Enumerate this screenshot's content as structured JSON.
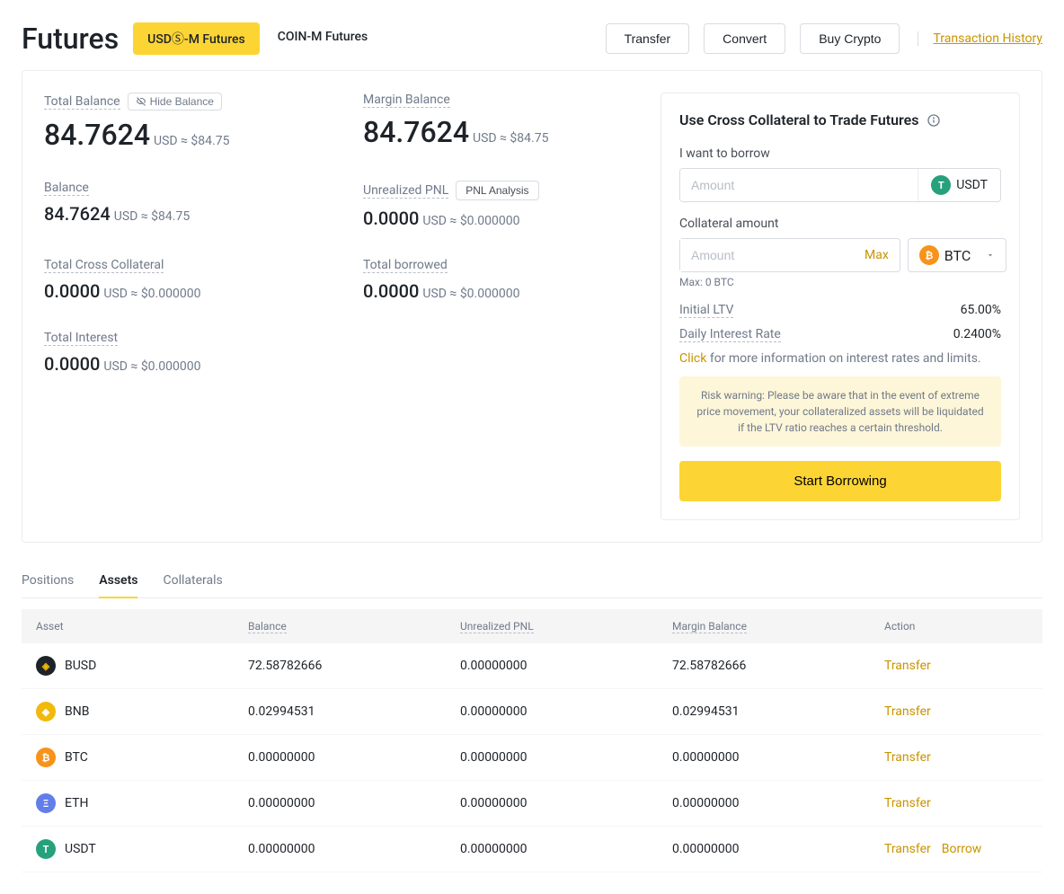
{
  "header": {
    "title": "Futures",
    "tabs": [
      "USDⓈ-M Futures",
      "COIN-M Futures"
    ],
    "buttons": {
      "transfer": "Transfer",
      "convert": "Convert",
      "buy": "Buy Crypto"
    },
    "history_link": "Transaction History"
  },
  "balances": {
    "total": {
      "label": "Total Balance",
      "hide_btn": "Hide Balance",
      "value": "84.7624",
      "suffix": "USD ≈ $84.75"
    },
    "margin": {
      "label": "Margin Balance",
      "value": "84.7624",
      "suffix": "USD ≈ $84.75"
    },
    "balance": {
      "label": "Balance",
      "value": "84.7624",
      "suffix": "USD ≈ $84.75"
    },
    "upnl": {
      "label": "Unrealized PNL",
      "pnl_btn": "PNL Analysis",
      "value": "0.0000",
      "suffix": "USD ≈ $0.000000"
    },
    "cross": {
      "label": "Total Cross Collateral",
      "value": "0.0000",
      "suffix": "USD ≈ $0.000000"
    },
    "borrowed": {
      "label": "Total borrowed",
      "value": "0.0000",
      "suffix": "USD ≈ $0.000000"
    },
    "interest": {
      "label": "Total Interest",
      "value": "0.0000",
      "suffix": "USD ≈ $0.000000"
    }
  },
  "borrow": {
    "header": "Use Cross Collateral to Trade Futures",
    "want_label": "I want to borrow",
    "amount_placeholder": "Amount",
    "borrow_coin": "USDT",
    "coll_label": "Collateral amount",
    "max_label": "Max",
    "coll_coin": "BTC",
    "max_hint": "Max: 0 BTC",
    "ltv_label": "Initial LTV",
    "ltv_value": "65.00%",
    "rate_label": "Daily Interest Rate",
    "rate_value": "0.2400%",
    "click_label": "Click",
    "click_text": " for more information on interest rates and limits.",
    "risk": "Risk warning: Please be aware that in the event of extreme price movement, your collateralized assets will be liquidated if the LTV ratio reaches a certain threshold.",
    "start_btn": "Start Borrowing"
  },
  "tabs": [
    "Positions",
    "Assets",
    "Collaterals"
  ],
  "table": {
    "headers": {
      "asset": "Asset",
      "balance": "Balance",
      "upnl": "Unrealized PNL",
      "margin": "Margin Balance",
      "action": "Action"
    },
    "rows": [
      {
        "icon_bg": "#1e2329",
        "icon_fg": "#f0b90b",
        "sym": "BUSD",
        "bal": "72.58782666",
        "upnl": "0.00000000",
        "margin": "72.58782666",
        "transfer": "Transfer",
        "borrow": ""
      },
      {
        "icon_bg": "#f0b90b",
        "icon_fg": "#fff",
        "sym": "BNB",
        "bal": "0.02994531",
        "upnl": "0.00000000",
        "margin": "0.02994531",
        "transfer": "Transfer",
        "borrow": ""
      },
      {
        "icon_bg": "#f7931a",
        "icon_fg": "#fff",
        "sym": "BTC",
        "bal": "0.00000000",
        "upnl": "0.00000000",
        "margin": "0.00000000",
        "transfer": "Transfer",
        "borrow": ""
      },
      {
        "icon_bg": "#627eea",
        "icon_fg": "#fff",
        "sym": "ETH",
        "bal": "0.00000000",
        "upnl": "0.00000000",
        "margin": "0.00000000",
        "transfer": "Transfer",
        "borrow": ""
      },
      {
        "icon_bg": "#26a17b",
        "icon_fg": "#fff",
        "sym": "USDT",
        "bal": "0.00000000",
        "upnl": "0.00000000",
        "margin": "0.00000000",
        "transfer": "Transfer",
        "borrow": "Borrow"
      }
    ]
  }
}
